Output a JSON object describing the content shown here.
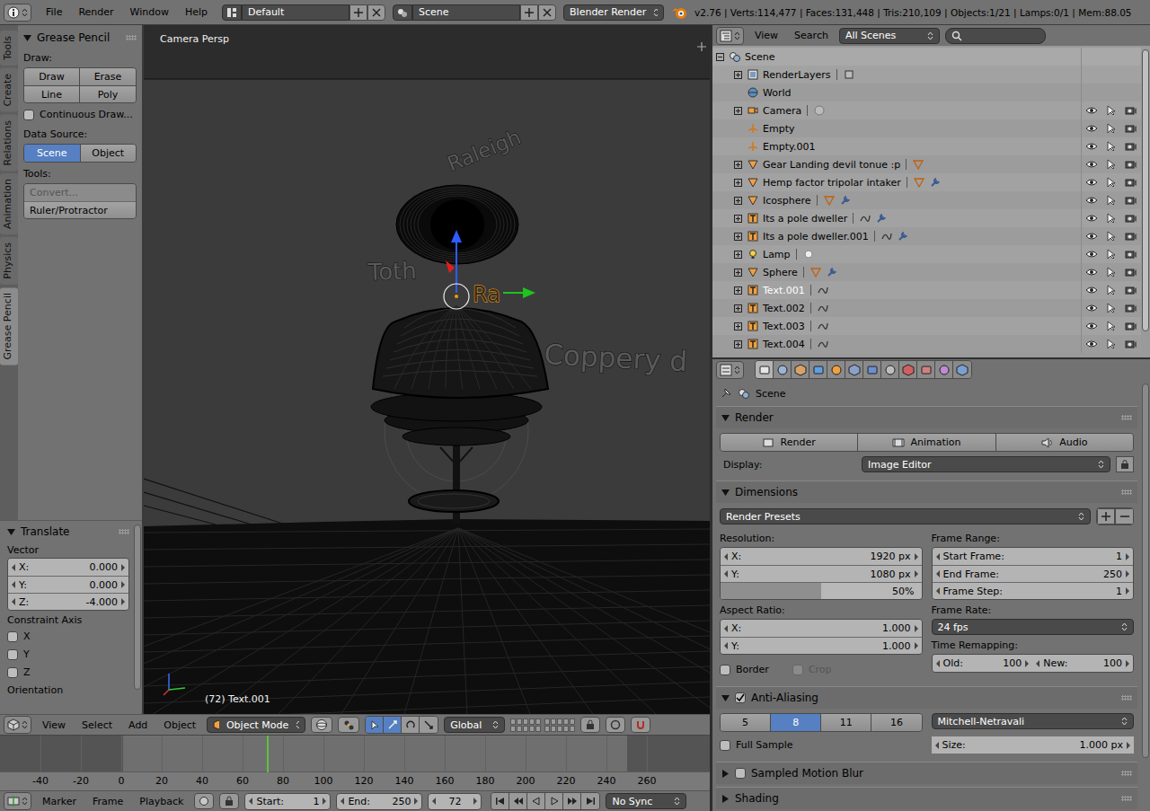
{
  "top_bar": {
    "menus": [
      "File",
      "Render",
      "Window",
      "Help"
    ],
    "layout": "Default",
    "scene": "Scene",
    "engine": "Blender Render",
    "stats": "v2.76 | Verts:114,477 | Faces:131,448 | Tris:210,109 | Objects:1/21 | Lamps:0/1 | Mem:88.05"
  },
  "tool_tabs": [
    {
      "label": "Tools",
      "selected": false
    },
    {
      "label": "Create",
      "selected": false
    },
    {
      "label": "Relations",
      "selected": false
    },
    {
      "label": "Animation",
      "selected": false
    },
    {
      "label": "Physics",
      "selected": false
    },
    {
      "label": "Grease Pencil",
      "selected": true
    }
  ],
  "grease_pencil": {
    "title": "Grease Pencil",
    "draw_label": "Draw:",
    "draw_buttons": [
      "Draw",
      "Erase",
      "Line",
      "Poly"
    ],
    "continuous": {
      "label": "Continuous Draw...",
      "checked": false
    },
    "data_source_label": "Data Source:",
    "data_source": [
      {
        "label": "Scene",
        "selected": true
      },
      {
        "label": "Object",
        "selected": false
      }
    ],
    "tools_label": "Tools:",
    "tools": [
      {
        "label": "Convert...",
        "disabled": true
      },
      {
        "label": "Ruler/Protractor",
        "disabled": false
      }
    ]
  },
  "translate": {
    "title": "Translate",
    "expanded": true,
    "vector_label": "Vector",
    "vector": [
      {
        "label": "X:",
        "value": "0.000"
      },
      {
        "label": "Y:",
        "value": "0.000"
      },
      {
        "label": "Z:",
        "value": "-4.000"
      }
    ],
    "constraint_label": "Constraint Axis",
    "constraints": [
      {
        "label": "X",
        "checked": false
      },
      {
        "label": "Y",
        "checked": false
      },
      {
        "label": "Z",
        "checked": false
      }
    ],
    "orientation_label": "Orientation"
  },
  "viewport": {
    "title": "Camera Persp",
    "scene_texts": [
      {
        "text": "Raleigh",
        "selected": false
      },
      {
        "text": "Toth",
        "selected": false
      },
      {
        "text": "Ra",
        "selected": true
      },
      {
        "text": "Coppery d",
        "selected": false
      }
    ],
    "status": "(72) Text.001"
  },
  "viewport_header": {
    "menus": [
      "View",
      "Select",
      "Add",
      "Object"
    ],
    "mode": "Object Mode",
    "orientation": "Global",
    "manipulators": [
      {
        "selected": true
      },
      {
        "selected": true
      },
      {
        "selected": false
      },
      {
        "selected": false
      }
    ]
  },
  "timeline": {
    "ticks": [
      "-40",
      "-20",
      "0",
      "20",
      "40",
      "60",
      "80",
      "100",
      "120",
      "140",
      "160",
      "180",
      "200",
      "220",
      "240",
      "260"
    ]
  },
  "timeline_header": {
    "menus": [
      "Marker",
      "Frame",
      "Playback"
    ],
    "start_label": "Start:",
    "start": "1",
    "end_label": "End:",
    "end": "250",
    "frame": "72",
    "sync": "No Sync"
  },
  "outliner": {
    "menus": [
      "View",
      "Search"
    ],
    "filter": "All Scenes",
    "search": "",
    "rows": [
      {
        "name": "Scene",
        "kind": "scene",
        "depth": 0,
        "expandable": true,
        "expanded": true,
        "selected": false,
        "restrict": false,
        "data_icon": false,
        "modifier": false
      },
      {
        "name": "RenderLayers",
        "kind": "renderlayers",
        "depth": 1,
        "expandable": true,
        "expanded": false,
        "selected": false,
        "restrict": false,
        "data_icon": true,
        "modifier": false
      },
      {
        "name": "World",
        "kind": "world",
        "depth": 1,
        "expandable": false,
        "expanded": false,
        "selected": false,
        "restrict": false,
        "data_icon": false,
        "modifier": false
      },
      {
        "name": "Camera",
        "kind": "camera",
        "depth": 1,
        "expandable": true,
        "expanded": false,
        "selected": false,
        "restrict": true,
        "data_icon": true,
        "modifier": false
      },
      {
        "name": "Empty",
        "kind": "empty",
        "depth": 1,
        "expandable": false,
        "expanded": false,
        "selected": false,
        "restrict": true,
        "data_icon": false,
        "modifier": false
      },
      {
        "name": "Empty.001",
        "kind": "empty",
        "depth": 1,
        "expandable": false,
        "expanded": false,
        "selected": false,
        "restrict": true,
        "data_icon": false,
        "modifier": false
      },
      {
        "name": "Gear Landing devil tonue :p",
        "kind": "mesh",
        "depth": 1,
        "expandable": true,
        "expanded": false,
        "selected": false,
        "restrict": true,
        "data_icon": true,
        "modifier": false
      },
      {
        "name": "Hemp factor tripolar intaker",
        "kind": "mesh",
        "depth": 1,
        "expandable": true,
        "expanded": false,
        "selected": false,
        "restrict": true,
        "data_icon": true,
        "modifier": true
      },
      {
        "name": "Icosphere",
        "kind": "mesh",
        "depth": 1,
        "expandable": true,
        "expanded": false,
        "selected": false,
        "restrict": true,
        "data_icon": true,
        "modifier": true
      },
      {
        "name": "Its a pole dweller",
        "kind": "font",
        "depth": 1,
        "expandable": true,
        "expanded": false,
        "selected": false,
        "restrict": true,
        "data_icon": true,
        "modifier": true
      },
      {
        "name": "Its a pole dweller.001",
        "kind": "font",
        "depth": 1,
        "expandable": true,
        "expanded": false,
        "selected": false,
        "restrict": true,
        "data_icon": true,
        "modifier": true
      },
      {
        "name": "Lamp",
        "kind": "lamp",
        "depth": 1,
        "expandable": true,
        "expanded": false,
        "selected": false,
        "restrict": true,
        "data_icon": true,
        "modifier": false
      },
      {
        "name": "Sphere",
        "kind": "mesh",
        "depth": 1,
        "expandable": true,
        "expanded": false,
        "selected": false,
        "restrict": true,
        "data_icon": true,
        "modifier": true
      },
      {
        "name": "Text.001",
        "kind": "font",
        "depth": 1,
        "expandable": true,
        "expanded": false,
        "selected": true,
        "restrict": true,
        "data_icon": true,
        "modifier": false
      },
      {
        "name": "Text.002",
        "kind": "font",
        "depth": 1,
        "expandable": true,
        "expanded": false,
        "selected": false,
        "restrict": true,
        "data_icon": true,
        "modifier": false
      },
      {
        "name": "Text.003",
        "kind": "font",
        "depth": 1,
        "expandable": true,
        "expanded": false,
        "selected": false,
        "restrict": true,
        "data_icon": true,
        "modifier": false
      },
      {
        "name": "Text.004",
        "kind": "font",
        "depth": 1,
        "expandable": true,
        "expanded": false,
        "selected": false,
        "restrict": true,
        "data_icon": true,
        "modifier": false
      }
    ]
  },
  "properties": {
    "tabs": [
      {
        "selected": true
      },
      {
        "selected": false
      },
      {
        "selected": false
      },
      {
        "selected": false
      },
      {
        "selected": false
      },
      {
        "selected": false
      },
      {
        "selected": false
      },
      {
        "selected": false
      },
      {
        "selected": false
      },
      {
        "selected": false
      },
      {
        "selected": false
      },
      {
        "selected": false
      }
    ],
    "context": "Scene",
    "render_panel": {
      "title": "Render",
      "expanded": true,
      "buttons": [
        "Render",
        "Animation",
        "Audio"
      ],
      "display_label": "Display:",
      "display": "Image Editor"
    },
    "dimensions": {
      "title": "Dimensions",
      "expanded": true,
      "presets": "Render Presets",
      "resolution_label": "Resolution:",
      "resolution": [
        {
          "label": "X:",
          "value": "1920 px"
        },
        {
          "label": "Y:",
          "value": "1080 px"
        }
      ],
      "percent": {
        "value": "50%",
        "level": 0.5
      },
      "frame_range_label": "Frame Range:",
      "frame_fields": [
        {
          "label": "Start Frame:",
          "value": "1"
        },
        {
          "label": "End Frame:",
          "value": "250"
        },
        {
          "label": "Frame Step:",
          "value": "1"
        }
      ],
      "aspect_label": "Aspect Ratio:",
      "aspect": [
        {
          "label": "X:",
          "value": "1.000"
        },
        {
          "label": "Y:",
          "value": "1.000"
        }
      ],
      "frame_rate_label": "Frame Rate:",
      "frame_rate": "24 fps",
      "border": {
        "label": "Border",
        "checked": false,
        "disabled": false
      },
      "crop": {
        "label": "Crop",
        "checked": false,
        "disabled": true
      },
      "remap_label": "Time Remapping:",
      "remap": [
        {
          "label": "Old:",
          "value": "100"
        },
        {
          "label": "New:",
          "value": "100"
        }
      ]
    },
    "anti_aliasing": {
      "title": "Anti-Aliasing",
      "enabled": true,
      "expanded": true,
      "samples": [
        {
          "label": "5",
          "selected": false
        },
        {
          "label": "8",
          "selected": true
        },
        {
          "label": "11",
          "selected": false
        },
        {
          "label": "16",
          "selected": false
        }
      ],
      "filter": "Mitchell-Netravali",
      "full_sample": {
        "label": "Full Sample",
        "checked": false
      },
      "size": {
        "label": "Size:",
        "value": "1.000 px"
      }
    },
    "collapsed_panels": [
      {
        "title": "Sampled Motion Blur",
        "has_checkbox": true,
        "enabled": false,
        "expanded": false
      },
      {
        "title": "Shading",
        "has_checkbox": false,
        "enabled": false,
        "expanded": false
      }
    ]
  }
}
